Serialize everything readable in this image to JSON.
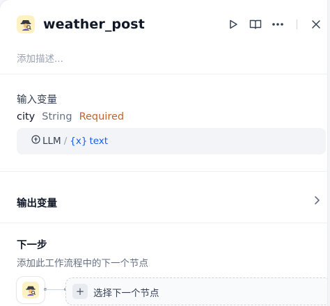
{
  "header": {
    "title": "weather_post",
    "avatar_icon": "detective-icon",
    "run_icon": "play-icon",
    "docs_icon": "book-icon",
    "more_icon": "more-icon",
    "close_icon": "close-icon"
  },
  "description": {
    "placeholder": "添加描述..."
  },
  "input_section": {
    "title": "输入变量",
    "variables": [
      {
        "name": "city",
        "type": "String",
        "required": "Required",
        "ref": {
          "source": "LLM",
          "separator": "/",
          "var_symbol": "{x}",
          "var_name": "text"
        }
      }
    ]
  },
  "output_section": {
    "title": "输出变量"
  },
  "next_step": {
    "title": "下一步",
    "subtitle": "添加此工作流程中的下一个节点",
    "select_label": "选择下一个节点",
    "plus": "+"
  },
  "colors": {
    "accent": "#155eef",
    "required": "#c4622d",
    "avatar_bg": "#fdf2c4"
  }
}
